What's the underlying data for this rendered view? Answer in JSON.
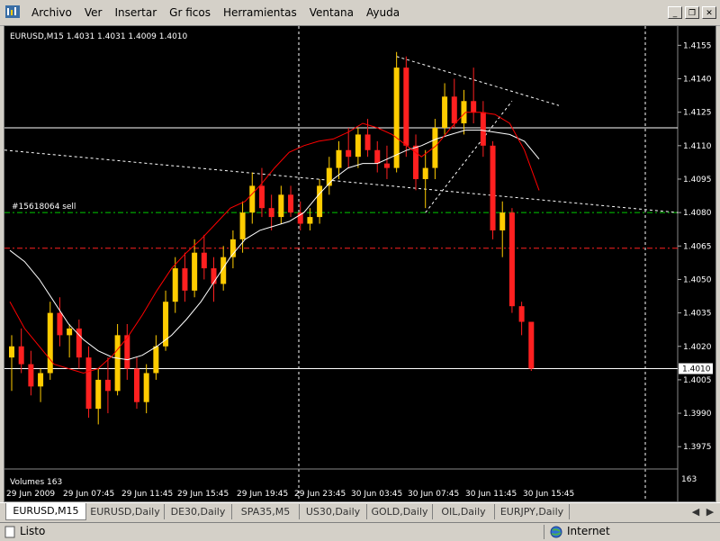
{
  "menu": {
    "items": [
      "Archivo",
      "Ver",
      "Insertar",
      "Gr ficos",
      "Herramientas",
      "Ventana",
      "Ayuda"
    ]
  },
  "chart": {
    "symbol_info": "EURUSD,M15  1.4031 1.4031 1.4009 1.4010",
    "order_label": "#15618064 sell",
    "current_price": "1.4010",
    "price_labels": [
      "1.4155",
      "1.4140",
      "1.4125",
      "1.4110",
      "1.4095",
      "1.4080",
      "1.4065",
      "1.4050",
      "1.4035",
      "1.4020",
      "1.4005",
      "1.3990",
      "1.3975"
    ],
    "volume_label": "Volumes 163",
    "volume_value": "163",
    "time_labels": [
      "29 Jun 2009",
      "29 Jun 07:45",
      "29 Jun 11:45",
      "29 Jun 15:45",
      "29 Jun 19:45",
      "29 Jun 23:45",
      "30 Jun 03:45",
      "30 Jun 07:45",
      "30 Jun 11:45",
      "30 Jun 15:45"
    ],
    "colors": {
      "bull": "#ffcc00",
      "bear": "#ff2020",
      "ma_fast": "#ff0000",
      "ma_slow": "#ffffff",
      "sl_line": "#ff2020",
      "order_line": "#00cc00"
    }
  },
  "tabs": [
    "EURUSD,M15",
    "EURUSD,Daily",
    "DE30,Daily",
    "SPA35,M5",
    "US30,Daily",
    "GOLD,Daily",
    "OIL,Daily",
    "EURJPY,Daily"
  ],
  "status": {
    "left": "Listo",
    "right": "Internet"
  },
  "chart_data": {
    "type": "candlestick",
    "price_range": [
      1.3965,
      1.4162
    ],
    "current_price": 1.401,
    "open_order_price": 1.408,
    "order_label": "#15618064 sell",
    "stop_line_price": 1.4064,
    "resistance_price": 1.4118,
    "support_price": 1.401,
    "ma_fast": [
      1.404,
      1.4028,
      1.402,
      1.4012,
      1.401,
      1.4008,
      1.401,
      1.4016,
      1.4024,
      1.4034,
      1.4045,
      1.4055,
      1.4062,
      1.4068,
      1.4075,
      1.4082,
      1.4085,
      1.4092,
      1.41,
      1.4107,
      1.411,
      1.4112,
      1.4113,
      1.4116,
      1.412,
      1.4118,
      1.4115,
      1.411,
      1.4105,
      1.411,
      1.4118,
      1.4125,
      1.4125,
      1.4124,
      1.412,
      1.4108,
      1.409
    ],
    "ma_slow": [
      1.4063,
      1.4058,
      1.405,
      1.404,
      1.403,
      1.4023,
      1.4018,
      1.4015,
      1.4014,
      1.4016,
      1.402,
      1.4025,
      1.4032,
      1.404,
      1.405,
      1.406,
      1.4068,
      1.4072,
      1.4074,
      1.4076,
      1.408,
      1.4088,
      1.4095,
      1.41,
      1.4102,
      1.4102,
      1.4105,
      1.4108,
      1.411,
      1.4113,
      1.4115,
      1.4117,
      1.4117,
      1.4116,
      1.4115,
      1.4112,
      1.4104
    ],
    "candles": [
      [
        1.4015,
        1.4025,
        1.4,
        1.402
      ],
      [
        1.402,
        1.4028,
        1.4008,
        1.4012
      ],
      [
        1.4012,
        1.4018,
        1.3998,
        1.4002
      ],
      [
        1.4002,
        1.401,
        1.3995,
        1.4008
      ],
      [
        1.4008,
        1.404,
        1.4005,
        1.4035
      ],
      [
        1.4035,
        1.4042,
        1.402,
        1.4025
      ],
      [
        1.4025,
        1.403,
        1.4015,
        1.4028
      ],
      [
        1.4028,
        1.4032,
        1.401,
        1.4015
      ],
      [
        1.4015,
        1.402,
        1.3988,
        1.3992
      ],
      [
        1.3992,
        1.401,
        1.3985,
        1.4005
      ],
      [
        1.4005,
        1.4015,
        1.399,
        1.4
      ],
      [
        1.4,
        1.403,
        1.3998,
        1.4025
      ],
      [
        1.4025,
        1.403,
        1.4005,
        1.401
      ],
      [
        1.401,
        1.4015,
        1.3992,
        1.3995
      ],
      [
        1.3995,
        1.4012,
        1.399,
        1.4008
      ],
      [
        1.4008,
        1.4025,
        1.4005,
        1.402
      ],
      [
        1.402,
        1.4045,
        1.4018,
        1.404
      ],
      [
        1.404,
        1.406,
        1.4035,
        1.4055
      ],
      [
        1.4055,
        1.4062,
        1.404,
        1.4045
      ],
      [
        1.4045,
        1.4068,
        1.4042,
        1.4062
      ],
      [
        1.4062,
        1.407,
        1.405,
        1.4055
      ],
      [
        1.4055,
        1.406,
        1.404,
        1.4048
      ],
      [
        1.4048,
        1.4065,
        1.4045,
        1.406
      ],
      [
        1.406,
        1.4072,
        1.4055,
        1.4068
      ],
      [
        1.4068,
        1.4085,
        1.4062,
        1.408
      ],
      [
        1.408,
        1.4098,
        1.4075,
        1.4092
      ],
      [
        1.4092,
        1.41,
        1.4078,
        1.4082
      ],
      [
        1.4082,
        1.4088,
        1.4072,
        1.4078
      ],
      [
        1.4078,
        1.4092,
        1.4075,
        1.4088
      ],
      [
        1.4088,
        1.4092,
        1.4078,
        1.408
      ],
      [
        1.408,
        1.4085,
        1.4072,
        1.4075
      ],
      [
        1.4075,
        1.4082,
        1.4072,
        1.4078
      ],
      [
        1.4078,
        1.4095,
        1.4075,
        1.4092
      ],
      [
        1.4092,
        1.4105,
        1.4088,
        1.41
      ],
      [
        1.41,
        1.4112,
        1.4095,
        1.4108
      ],
      [
        1.4108,
        1.4118,
        1.41,
        1.4105
      ],
      [
        1.4105,
        1.4118,
        1.41,
        1.4115
      ],
      [
        1.4115,
        1.4122,
        1.4105,
        1.4108
      ],
      [
        1.4108,
        1.4112,
        1.4098,
        1.4102
      ],
      [
        1.4102,
        1.411,
        1.4095,
        1.41
      ],
      [
        1.41,
        1.4152,
        1.4098,
        1.4145
      ],
      [
        1.4145,
        1.415,
        1.4105,
        1.411
      ],
      [
        1.411,
        1.4115,
        1.409,
        1.4095
      ],
      [
        1.4095,
        1.4108,
        1.4082,
        1.41
      ],
      [
        1.41,
        1.4122,
        1.4095,
        1.4118
      ],
      [
        1.4118,
        1.4138,
        1.4115,
        1.4132
      ],
      [
        1.4132,
        1.414,
        1.4118,
        1.412
      ],
      [
        1.412,
        1.4135,
        1.4115,
        1.413
      ],
      [
        1.413,
        1.4145,
        1.412,
        1.4125
      ],
      [
        1.4125,
        1.413,
        1.4105,
        1.411
      ],
      [
        1.411,
        1.4112,
        1.4068,
        1.4072
      ],
      [
        1.4072,
        1.4085,
        1.406,
        1.408
      ],
      [
        1.408,
        1.4082,
        1.4035,
        1.4038
      ],
      [
        1.4038,
        1.404,
        1.4025,
        1.4031
      ],
      [
        1.4031,
        1.4031,
        1.4009,
        1.401
      ]
    ],
    "volumes_label": "Volumes 163",
    "time_labels": [
      "29 Jun 2009",
      "29 Jun 07:45",
      "29 Jun 11:45",
      "29 Jun 15:45",
      "29 Jun 19:45",
      "29 Jun 23:45",
      "30 Jun 03:45",
      "30 Jun 07:45",
      "30 Jun 11:45",
      "30 Jun 15:45"
    ],
    "price_labels": [
      "1.4155",
      "1.4140",
      "1.4125",
      "1.4110",
      "1.4095",
      "1.4080",
      "1.4065",
      "1.4050",
      "1.4035",
      "1.4020",
      "1.4005",
      "1.3990",
      "1.3975"
    ]
  }
}
